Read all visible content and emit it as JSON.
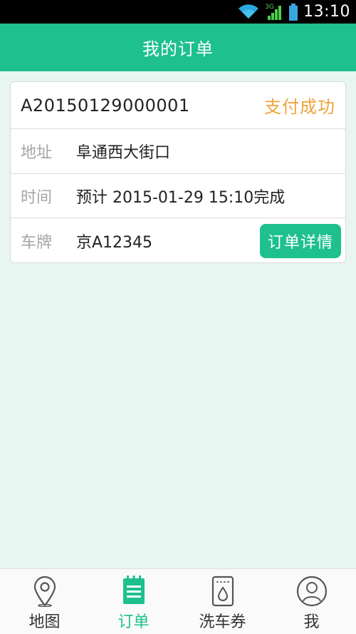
{
  "status_bar": {
    "network_label": "3G",
    "time": "13:10"
  },
  "header": {
    "title": "我的订单"
  },
  "order": {
    "number": "A20150129000001",
    "status": "支付成功",
    "address_label": "地址",
    "address_value": "阜通西大街口",
    "time_label": "时间",
    "time_value": "预计 2015-01-29 15:10完成",
    "plate_label": "车牌",
    "plate_value": "京A12345",
    "detail_button": "订单详情"
  },
  "tabs": [
    {
      "label": "地图",
      "icon": "map-pin-icon",
      "active": false
    },
    {
      "label": "订单",
      "icon": "order-list-icon",
      "active": true
    },
    {
      "label": "洗车券",
      "icon": "wash-coupon-icon",
      "active": false
    },
    {
      "label": "我",
      "icon": "user-icon",
      "active": false
    }
  ],
  "colors": {
    "accent": "#1ec08d",
    "status_success": "#f0a23b",
    "background": "#e8f6f1"
  }
}
